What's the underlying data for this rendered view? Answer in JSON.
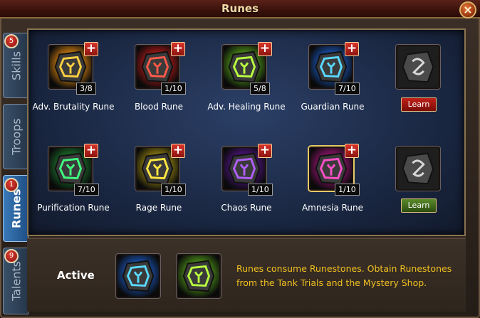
{
  "window": {
    "title": "Runes",
    "close_label": "×"
  },
  "tabs": [
    {
      "label": "Skills",
      "badge": "5",
      "active": false
    },
    {
      "label": "Troops",
      "badge": "",
      "active": false
    },
    {
      "label": "Runes",
      "badge": "1",
      "active": true
    },
    {
      "label": "Talents",
      "badge": "9",
      "active": false
    }
  ],
  "runes": [
    {
      "name": "Adv. Brutality Rune",
      "level": "3/8",
      "color": "#c87a10",
      "glyph": "#ffcf40"
    },
    {
      "name": "Blood Rune",
      "level": "1/10",
      "color": "#a01818",
      "glyph": "#ff5a4a"
    },
    {
      "name": "Adv. Healing Rune",
      "level": "5/8",
      "color": "#4a8a18",
      "glyph": "#b8ff40"
    },
    {
      "name": "Guardian Rune",
      "level": "7/10",
      "color": "#1a4ea8",
      "glyph": "#5ad8ff"
    },
    {
      "name": "Purification Rune",
      "level": "7/10",
      "color": "#1a6a2a",
      "glyph": "#40ff80"
    },
    {
      "name": "Rage Rune",
      "level": "1/10",
      "color": "#8a7a10",
      "glyph": "#ffe840"
    },
    {
      "name": "Chaos Rune",
      "level": "1/10",
      "color": "#4a1478",
      "glyph": "#b060ff"
    },
    {
      "name": "Amnesia Rune",
      "level": "1/10",
      "color": "#8a1468",
      "glyph": "#ff50c8"
    }
  ],
  "plus_label": "+",
  "learn_buttons": [
    {
      "label": "Learn",
      "color": "#c02018"
    },
    {
      "label": "Learn",
      "color": "#5a8a2a"
    }
  ],
  "active_section": {
    "label": "Active",
    "slots": [
      {
        "color": "#1a4ea8",
        "glyph": "#5ad8ff"
      },
      {
        "color": "#4a8a18",
        "glyph": "#b8ff40"
      }
    ],
    "info_text": "Runes consume Runestones. Obtain Runestones from the Tank Trials and the Mystery Shop."
  }
}
